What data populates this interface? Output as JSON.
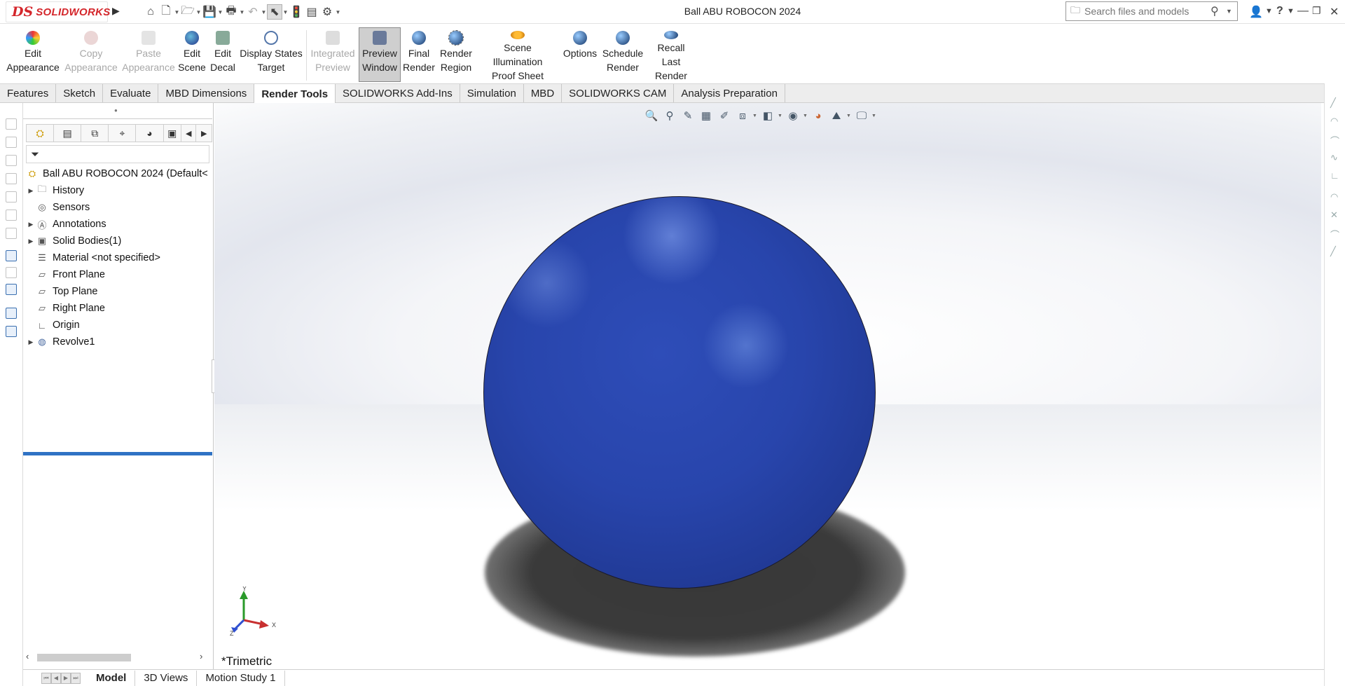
{
  "app": {
    "brand_mark": "DS",
    "brand_name": "SOLIDWORKS",
    "document_title": "Ball ABU ROBOCON 2024",
    "search_placeholder": "Search files and models",
    "help_label": "?"
  },
  "ribbon": {
    "buttons": [
      {
        "line1": "Edit",
        "line2": "Appearance",
        "enabled": true,
        "icon": "appearance-icon"
      },
      {
        "line1": "Copy",
        "line2": "Appearance",
        "enabled": false,
        "icon": "copy-appearance-icon"
      },
      {
        "line1": "Paste",
        "line2": "Appearance",
        "enabled": false,
        "icon": "paste-appearance-icon"
      },
      {
        "line1": "Edit",
        "line2": "Scene",
        "enabled": true,
        "icon": "scene-icon"
      },
      {
        "line1": "Edit",
        "line2": "Decal",
        "enabled": true,
        "icon": "decal-icon"
      },
      {
        "line1": "Display States",
        "line2": "Target",
        "enabled": true,
        "icon": "target-icon"
      },
      {
        "line1": "Integrated",
        "line2": "Preview",
        "enabled": false,
        "icon": "integrated-preview-icon"
      },
      {
        "line1": "Preview",
        "line2": "Window",
        "enabled": true,
        "active": true,
        "icon": "preview-window-icon"
      },
      {
        "line1": "Final",
        "line2": "Render",
        "enabled": true,
        "icon": "final-render-icon"
      },
      {
        "line1": "Render",
        "line2": "Region",
        "enabled": true,
        "icon": "render-region-icon"
      },
      {
        "line1": "Scene Illumination",
        "line2": "Proof Sheet",
        "enabled": true,
        "icon": "proof-sheet-icon"
      },
      {
        "line1": "Options",
        "line2": "",
        "enabled": true,
        "icon": "options-icon"
      },
      {
        "line1": "Schedule",
        "line2": "Render",
        "enabled": true,
        "icon": "schedule-render-icon"
      },
      {
        "line1": "Recall Last",
        "line2": "Render",
        "enabled": true,
        "icon": "recall-render-icon"
      }
    ]
  },
  "command_tabs": [
    "Features",
    "Sketch",
    "Evaluate",
    "MBD Dimensions",
    "Render Tools",
    "SOLIDWORKS Add-Ins",
    "Simulation",
    "MBD",
    "SOLIDWORKS CAM",
    "Analysis Preparation"
  ],
  "active_tab": "Render Tools",
  "feature_tree": {
    "root": "Ball ABU ROBOCON 2024  (Default<",
    "items": [
      {
        "label": "History",
        "expandable": true,
        "icon": "history-folder-icon"
      },
      {
        "label": "Sensors",
        "expandable": false,
        "icon": "sensors-icon"
      },
      {
        "label": "Annotations",
        "expandable": true,
        "icon": "annotations-icon"
      },
      {
        "label": "Solid Bodies(1)",
        "expandable": true,
        "icon": "solid-bodies-icon"
      },
      {
        "label": "Material <not specified>",
        "expandable": false,
        "icon": "material-icon"
      },
      {
        "label": "Front Plane",
        "expandable": false,
        "icon": "plane-icon"
      },
      {
        "label": "Top Plane",
        "expandable": false,
        "icon": "plane-icon"
      },
      {
        "label": "Right Plane",
        "expandable": false,
        "icon": "plane-icon"
      },
      {
        "label": "Origin",
        "expandable": false,
        "icon": "origin-icon"
      },
      {
        "label": "Revolve1",
        "expandable": true,
        "icon": "revolve-icon"
      }
    ]
  },
  "viewport": {
    "view_name": "*Trimetric",
    "model_color": "#2b48b0",
    "axis_labels": {
      "x": "X",
      "y": "Y",
      "z": "Z"
    }
  },
  "bottom_tabs": [
    "Model",
    "3D Views",
    "Motion Study 1"
  ],
  "active_bottom_tab": "Model",
  "colors": {
    "brand_red": "#d4262b",
    "tree_end_bar": "#2f72c4",
    "ball_blue": "#2845ac"
  }
}
